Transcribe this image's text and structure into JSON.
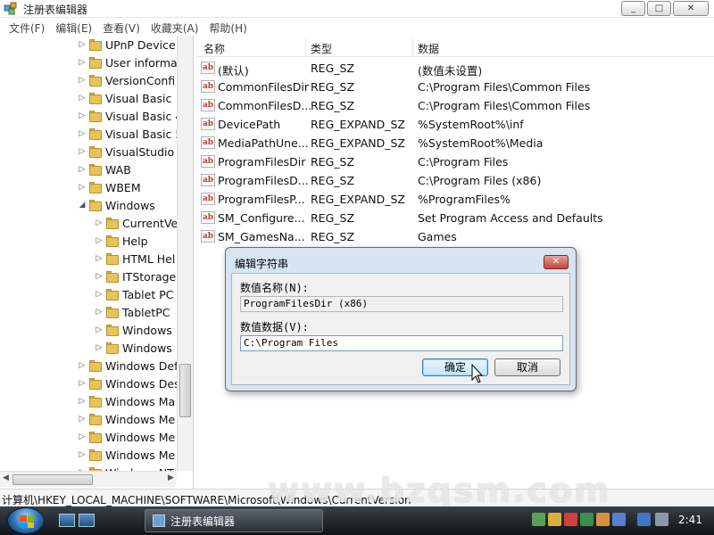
{
  "window": {
    "title": "注册表编辑器",
    "buttons": {
      "minimize": "_",
      "maximize": "□",
      "close": "✕"
    }
  },
  "menu": [
    "文件(F)",
    "编辑(E)",
    "查看(V)",
    "收藏夹(A)",
    "帮助(H)"
  ],
  "tree": {
    "items": [
      {
        "label": "UPnP Device",
        "level": 0,
        "expanded": false
      },
      {
        "label": "User informa",
        "level": 0,
        "expanded": false
      },
      {
        "label": "VersionConfi",
        "level": 0,
        "expanded": false
      },
      {
        "label": "Visual Basic",
        "level": 0,
        "expanded": false
      },
      {
        "label": "Visual Basic 4",
        "level": 0,
        "expanded": false
      },
      {
        "label": "Visual Basic 5",
        "level": 0,
        "expanded": false
      },
      {
        "label": "VisualStudio",
        "level": 0,
        "expanded": false
      },
      {
        "label": "WAB",
        "level": 0,
        "expanded": false
      },
      {
        "label": "WBEM",
        "level": 0,
        "expanded": false
      },
      {
        "label": "Windows",
        "level": 0,
        "expanded": true
      },
      {
        "label": "CurrentVe",
        "level": 1,
        "expanded": false
      },
      {
        "label": "Help",
        "level": 1,
        "expanded": false
      },
      {
        "label": "HTML Hel",
        "level": 1,
        "expanded": false
      },
      {
        "label": "ITStorage",
        "level": 1,
        "expanded": false
      },
      {
        "label": "Tablet PC",
        "level": 1,
        "expanded": false
      },
      {
        "label": "TabletPC",
        "level": 1,
        "expanded": false
      },
      {
        "label": "Windows",
        "level": 1,
        "expanded": false
      },
      {
        "label": "Windows",
        "level": 1,
        "expanded": false
      },
      {
        "label": "Windows Def",
        "level": 0,
        "expanded": false
      },
      {
        "label": "Windows Des",
        "level": 0,
        "expanded": false
      },
      {
        "label": "Windows Ma",
        "level": 0,
        "expanded": false
      },
      {
        "label": "Windows Me",
        "level": 0,
        "expanded": false
      },
      {
        "label": "Windows Me",
        "level": 0,
        "expanded": false
      },
      {
        "label": "Windows Me",
        "level": 0,
        "expanded": false
      },
      {
        "label": "Windows NT",
        "level": 0,
        "expanded": false
      }
    ]
  },
  "list": {
    "columns": {
      "name": "名称",
      "type": "类型",
      "data": "数据"
    },
    "rows": [
      {
        "name": "(默认)",
        "type": "REG_SZ",
        "data": "(数值未设置)"
      },
      {
        "name": "CommonFilesDir",
        "type": "REG_SZ",
        "data": "C:\\Program Files\\Common Files"
      },
      {
        "name": "CommonFilesD...",
        "type": "REG_SZ",
        "data": "C:\\Program Files\\Common Files"
      },
      {
        "name": "DevicePath",
        "type": "REG_EXPAND_SZ",
        "data": "%SystemRoot%\\inf"
      },
      {
        "name": "MediaPathUne...",
        "type": "REG_EXPAND_SZ",
        "data": "%SystemRoot%\\Media"
      },
      {
        "name": "ProgramFilesDir",
        "type": "REG_SZ",
        "data": "C:\\Program Files"
      },
      {
        "name": "ProgramFilesD...",
        "type": "REG_SZ",
        "data": "C:\\Program Files (x86)"
      },
      {
        "name": "ProgramFilesP...",
        "type": "REG_EXPAND_SZ",
        "data": "%ProgramFiles%"
      },
      {
        "name": "SM_Configure...",
        "type": "REG_SZ",
        "data": "Set Program Access and Defaults"
      },
      {
        "name": "SM_GamesNa...",
        "type": "REG_SZ",
        "data": "Games"
      }
    ],
    "icon_text": "ab"
  },
  "status": {
    "path": "计算机\\HKEY_LOCAL_MACHINE\\SOFTWARE\\Microsoft\\Windows\\CurrentVersion"
  },
  "watermark": "www.bzqsm.com",
  "dialog": {
    "title": "编辑字符串",
    "close": "✕",
    "name_label": "数值名称(N):",
    "name_value": "ProgramFilesDir (x86)",
    "data_label": "数值数据(V):",
    "data_value": "C:\\Program Files",
    "ok": "确定",
    "cancel": "取消"
  },
  "taskbar": {
    "task_label": "注册表编辑器",
    "clock": "2:41"
  }
}
